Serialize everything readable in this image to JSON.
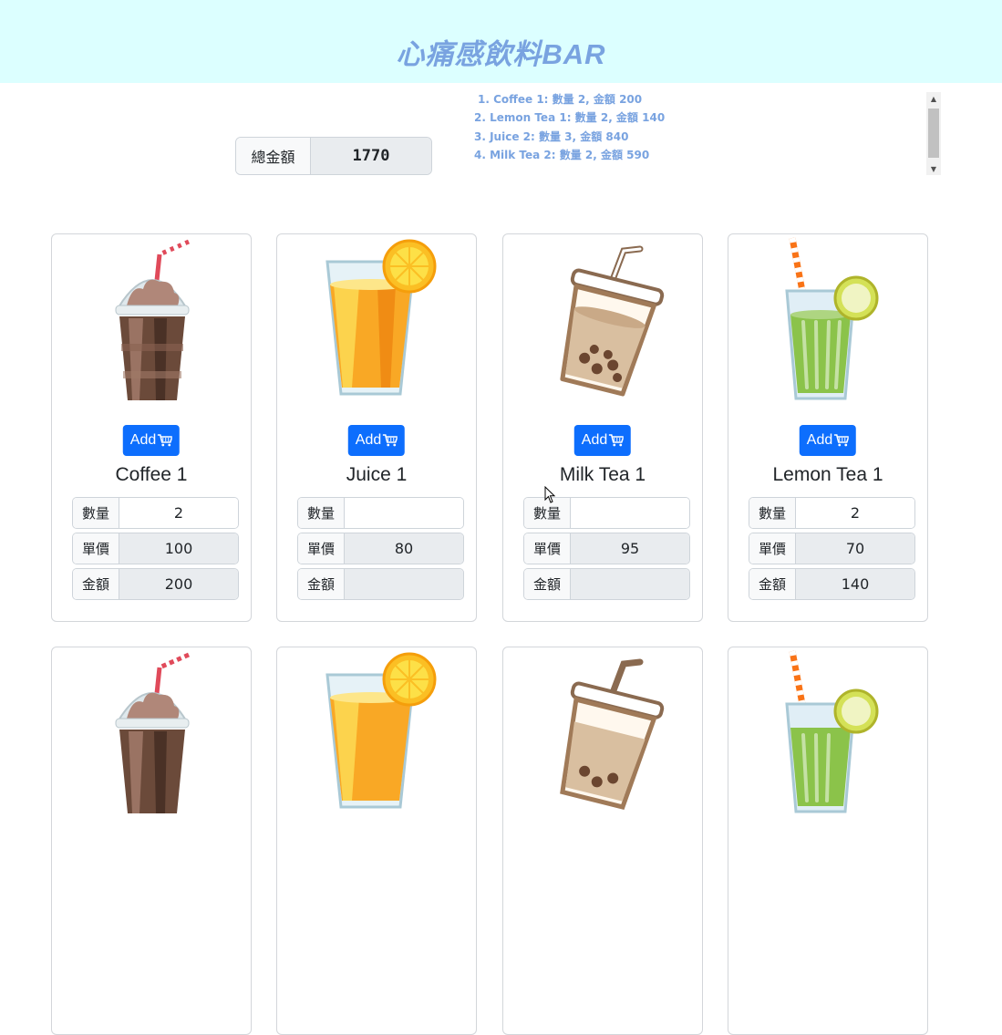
{
  "header": {
    "title": "心痛感飲料BAR"
  },
  "total": {
    "label": "總金額",
    "value": "1770"
  },
  "orders": [
    "1. Coffee 1: 數量 2, 金額 200",
    "2. Lemon Tea 1: 數量 2, 金額 140",
    "3. Juice 2: 數量 3, 金額 840",
    "4. Milk Tea 2: 數量 2, 金額 590"
  ],
  "labels": {
    "qty": "數量",
    "price": "單價",
    "amount": "金額",
    "add": "Add"
  },
  "icons": {
    "add": "cart-icon"
  },
  "colors": {
    "banner": "#dcffff",
    "title": "#79a3e0",
    "button": "#0d6efd"
  },
  "products": [
    {
      "name": "Coffee 1",
      "image": "coffee-frappe",
      "qty": "2",
      "price": "100",
      "amount": "200"
    },
    {
      "name": "Juice 1",
      "image": "orange-juice",
      "qty": "",
      "price": "80",
      "amount": ""
    },
    {
      "name": "Milk Tea 1",
      "image": "bubble-milk-tea",
      "qty": "",
      "price": "95",
      "amount": ""
    },
    {
      "name": "Lemon Tea 1",
      "image": "lemon-tea",
      "qty": "2",
      "price": "70",
      "amount": "140"
    },
    {
      "image": "coffee-frappe"
    },
    {
      "image": "orange-juice"
    },
    {
      "image": "bubble-milk-tea"
    },
    {
      "image": "lemon-tea"
    }
  ]
}
